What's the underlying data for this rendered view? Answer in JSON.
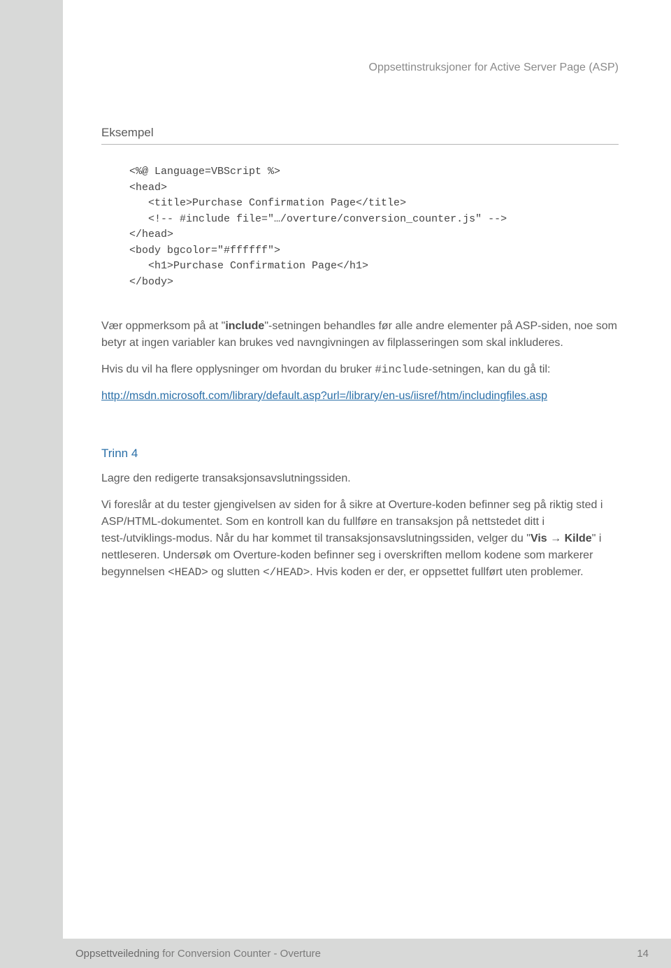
{
  "header": {
    "title": "Oppsettinstruksjoner for Active Server Page (ASP)"
  },
  "sections": {
    "example_heading": "Eksempel",
    "code": "<%@ Language=VBScript %>\n<head>\n   <title>Purchase Confirmation Page</title>\n   <!-- #include file=\"…/overture/conversion_counter.js\" -->\n</head>\n<body bgcolor=\"#ffffff\">\n   <h1>Purchase Confirmation Page</h1>\n</body>",
    "para1_pre": "Vær oppmerksom på at \"",
    "para1_bold": "include",
    "para1_post": "\"-setningen behandles før alle andre elementer på ASP-siden, noe som betyr at ingen variabler kan brukes ved navngivningen av filplasseringen som skal inkluderes.",
    "para2_pre": "Hvis du vil ha flere opplysninger om hvordan du bruker ",
    "para2_code": "#include",
    "para2_post": "-setningen, kan du gå til:",
    "link_text": "http://msdn.microsoft.com/library/default.asp?url=/library/en-us/iisref/htm/includingfiles.asp",
    "step4_heading": "Trinn 4",
    "step4_p1": "Lagre den redigerte transaksjonsavslutningssiden.",
    "step4_p2_a": "Vi foreslår at du tester gjengivelsen av siden for å sikre at Overture-koden befinner seg på riktig sted i ASP/HTML-dokumentet. Som en kontroll kan du fullføre en transaksjon på nettstedet ditt i test-/utviklings-modus. Når du har kommet til transaksjonsavslutningssiden, velger du \"",
    "step4_vis": "Vis",
    "step4_arrow": " → ",
    "step4_kilde": "Kilde",
    "step4_p2_b": "\" i nettleseren. Undersøk om Overture-koden befinner seg i overskriften mellom kodene som markerer begynnelsen ",
    "step4_head_open": "<HEAD>",
    "step4_p2_c": " og slutten ",
    "step4_head_close": "</HEAD>",
    "step4_p2_d": ". Hvis koden er der, er oppsettet fullført uten problemer."
  },
  "footer": {
    "bold": "Oppsettveiledning",
    "rest": " for Conversion Counter - Overture",
    "page": "14"
  }
}
